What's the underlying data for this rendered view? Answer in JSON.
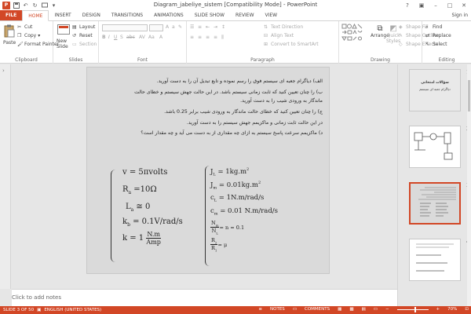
{
  "window": {
    "title": "Diagram_jabeliye_sistem [Compatibility Mode] - PowerPoint",
    "minimize": "–",
    "maximize": "□",
    "close": "✕",
    "help": "?",
    "restore": "▣"
  },
  "tabs": [
    "FILE",
    "HOME",
    "INSERT",
    "DESIGN",
    "TRANSITIONS",
    "ANIMATIONS",
    "SLIDE SHOW",
    "REVIEW",
    "VIEW"
  ],
  "signin": "Sign in",
  "ribbon": {
    "clipboard": {
      "label": "Clipboard",
      "paste": "Paste",
      "cut": "Cut",
      "copy": "Copy",
      "format_painter": "Format Painter"
    },
    "slides": {
      "label": "Slides",
      "new_slide": "New",
      "new_slide2": "Slide",
      "layout": "Layout",
      "reset": "Reset",
      "section": "Section"
    },
    "font": {
      "label": "Font"
    },
    "paragraph": {
      "label": "Paragraph",
      "text_direction": "Text Direction",
      "align_text": "Align Text",
      "convert_smartart": "Convert to SmartArt"
    },
    "drawing": {
      "label": "Drawing",
      "arrange": "Arrange",
      "quick_styles": "Quick",
      "quick_styles2": "Styles",
      "shape_fill": "Shape Fill",
      "shape_outline": "Shape Outline",
      "shape_effects": "Shape Effects"
    },
    "editing": {
      "label": "Editing",
      "find": "Find",
      "replace": "Replace",
      "select": "Select"
    }
  },
  "slide": {
    "lines": [
      "الف) دیاگرام جعبه ای سیستم فوق را رسم نموده و تابع تبدیل آن را به دست آورید.",
      "ب) را چنان تعیین کنید که ثابت زمانی سیستم باشد. در این حالت جهش سیستم و خطای حالت",
      "ماندگار به ورودی شیب را به دست آورید.",
      "ج) را چنان تعیین کنید که خطای حالت ماندگار به ورودی شیب برابر 0.25 باشد.",
      "در این حالت ثابت زمانی و ماکزیمم جهش سیستم را به دست آورید.",
      "د) ماکزیمم سرعت پاسخ سیستم به ازای چه مقداری از به دست می آید و چه مقدار است؟"
    ],
    "left_eqs": {
      "v": "v = 5πvolts",
      "ra": "R",
      "ra_sub": "a",
      "ra_rest": " =10Ω",
      "la": "L",
      "la_sub": "a",
      "la_rest": " ≅ 0",
      "kb": "k",
      "kb_sub": "b",
      "kb_rest": " = 0.1V/rad/s",
      "k_lhs": "k = 1",
      "k_num": "N.m",
      "k_den": "Amp"
    },
    "right_eqs": {
      "jl": "J",
      "jl_sub": "L",
      "jl_rest": " = 1kg.m",
      "jl_sup": "2",
      "jm": "J",
      "jm_sub": "m",
      "jm_rest": " = 0.01kg.m",
      "jm_sup": "2",
      "cl": "c",
      "cl_sub": "L",
      "cl_rest": " = 1N.m/rad/s",
      "cm": "c",
      "cm_sub": "m",
      "cm_rest": " = 0.01 N.m/rad/s",
      "n_num": "N",
      "n_num_sub": "m",
      "n_den": "N",
      "n_den_sub": "L",
      "n_rest": " = n = 0.1",
      "r_num": "R",
      "r_num_sub": "2",
      "r_den": "R",
      "r_den_sub": "1",
      "r_rest": " = μ"
    }
  },
  "notes_placeholder": "Click to add notes",
  "thumbnails": [
    {
      "num": "1",
      "title": "سؤالات امتحانی",
      "subtitle": "دیاگرام جعبه ای سیستم"
    },
    {
      "num": "2",
      "star": "★"
    },
    {
      "num": "3",
      "star": "★"
    },
    {
      "num": "4",
      "star": "★"
    }
  ],
  "status": {
    "slide_of": "SLIDE 3 OF 50",
    "language": "ENGLISH (UNITED STATES)",
    "notes": "NOTES",
    "comments": "COMMENTS",
    "zoom": "70%"
  }
}
